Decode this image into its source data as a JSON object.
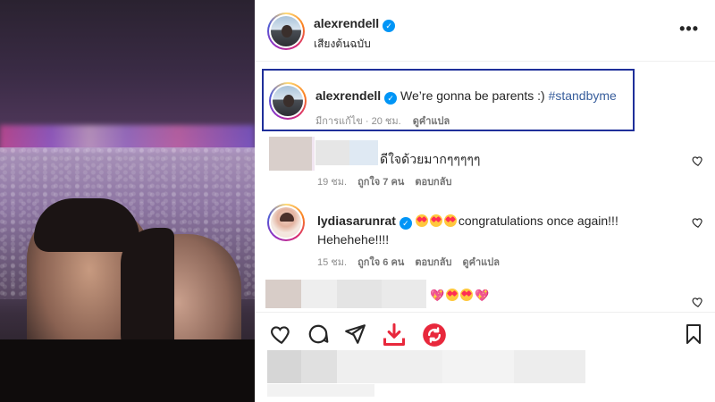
{
  "post": {
    "author": "alexrendell",
    "audio_label": "เสียงต้นฉบับ",
    "more_label": "•••"
  },
  "caption": {
    "author": "alexrendell",
    "text": "We’re gonna be parents :)",
    "hashtag": "#standbyme",
    "edited": "มีการแก้ไข · 20 ชม.",
    "translate": "ดูคำแปล"
  },
  "comments": [
    {
      "text": "ดีใจด้วยมากๆๆๆๆๆ",
      "time": "19 ชม.",
      "likes": "ถูกใจ 7 คน",
      "reply": "ตอบกลับ"
    },
    {
      "author": "lydiasarunrat",
      "text": "congratulations once again!!! Hehehehe!!!!",
      "time": "15 ชม.",
      "likes": "ถูกใจ 6 คน",
      "reply": "ตอบกลับ",
      "translate": "ดูคำแปล"
    }
  ],
  "colors": {
    "highlight_border": "#1f2f9a",
    "hashtag": "#385e9c",
    "verified": "#0095f6",
    "save_arrow": "#e8283c"
  },
  "icons": [
    "like-icon",
    "comment-icon",
    "share-icon",
    "download-icon",
    "refresh-icon",
    "bookmark-icon",
    "heart-outline-icon",
    "verified-badge-icon"
  ]
}
